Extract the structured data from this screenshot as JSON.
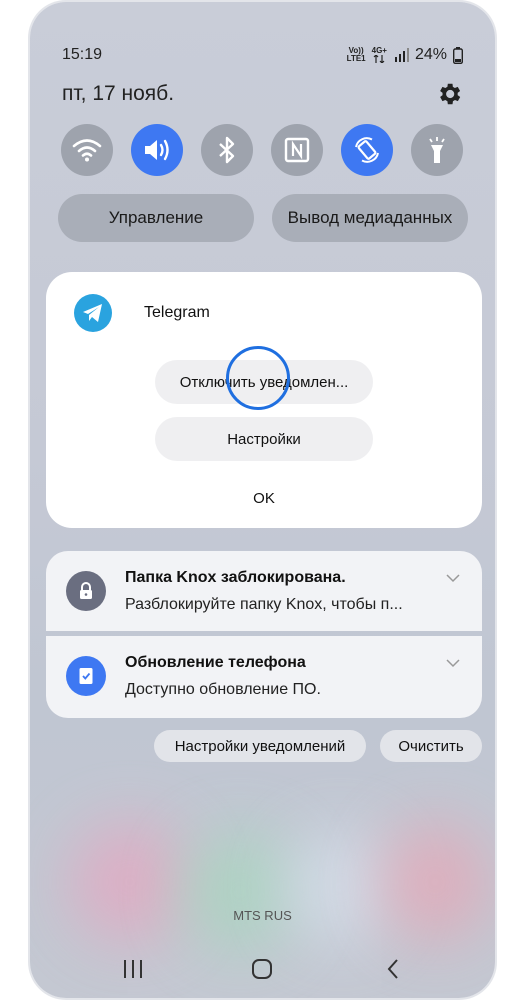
{
  "status_bar": {
    "time": "15:19",
    "volte": "Vo))",
    "lte": "LTE1",
    "net": "4G+",
    "battery": "24%"
  },
  "date": "пт, 17 нояб.",
  "quick_settings": {
    "tiles": [
      {
        "icon": "wifi-icon",
        "on": false
      },
      {
        "icon": "sound-icon",
        "on": true
      },
      {
        "icon": "bluetooth-icon",
        "on": false
      },
      {
        "icon": "nfc-icon",
        "on": false
      },
      {
        "icon": "autorotate-icon",
        "on": true
      },
      {
        "icon": "flashlight-icon",
        "on": false
      }
    ],
    "control_label": "Управление",
    "media_output_label": "Вывод медиаданных"
  },
  "dialog": {
    "app_name": "Telegram",
    "disable_label": "Отключить уведомлен...",
    "settings_label": "Настройки",
    "ok_label": "OK"
  },
  "notifications": [
    {
      "icon": "lock-icon",
      "title": "Папка Knox заблокирована.",
      "text": "Разблокируйте папку Knox, чтобы п..."
    },
    {
      "icon": "phone-update-icon",
      "title": "Обновление телефона",
      "text": "Доступно обновление ПО."
    }
  ],
  "notification_settings_label": "Настройки уведомлений",
  "clear_label": "Очистить",
  "carrier": "MTS RUS",
  "colors": {
    "accent": "#3e78f2",
    "telegram": "#2aa3df",
    "ring": "#1f6fe0"
  }
}
